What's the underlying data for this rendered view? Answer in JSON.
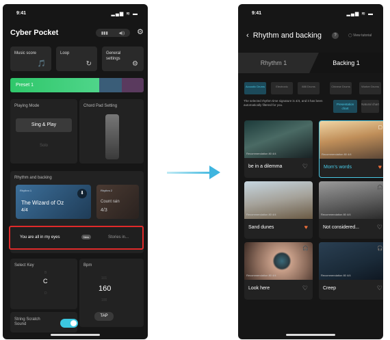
{
  "left": {
    "status": {
      "time": "9:41",
      "icons": "▂▄▆ ≋ ▬"
    },
    "app_title": "Cyber Pocket",
    "header_toggles": [
      "▮▮▮",
      "◀))"
    ],
    "nav_cards": [
      {
        "label": "Music score",
        "icon": "🎵"
      },
      {
        "label": "Loop",
        "icon": "↻"
      },
      {
        "label": "General settings",
        "icon": "⚙"
      }
    ],
    "preset": {
      "label": "Preset 1"
    },
    "playing_mode": {
      "title": "Playing Mode",
      "option1": "Sing & Play",
      "option2": "Solo"
    },
    "chord_pad": {
      "title": "Chord Pad Setting"
    },
    "rhythm_section": {
      "title": "Rhythm and backing",
      "card_active": {
        "tag": "Rhythm 1",
        "name": "The Wizard of Oz",
        "signature": "4/4"
      },
      "card_inactive": {
        "tag": "Rhythm 2",
        "name": "Count rain",
        "signature": "4/3"
      }
    },
    "highlighted_row": {
      "song": "You are all in my eyes",
      "badge": "New",
      "story": "Stories in..."
    },
    "select_key": {
      "title": "Select Key",
      "above": "B",
      "value": "C",
      "below": "D"
    },
    "bpm": {
      "title": "Bpm",
      "above": "101",
      "value": "160",
      "below": "100",
      "tap": "TAP"
    },
    "string_scratch": {
      "label": "String Scratch Sound",
      "enabled": true
    }
  },
  "right": {
    "status": {
      "time": "9:41",
      "icons": "▂▄▆ ≋ ▬"
    },
    "nav": {
      "title": "Rhythm and backing",
      "help": "?",
      "video_label": "◯ View tutorial"
    },
    "tabs": [
      "Rhythm 1",
      "Backing 1"
    ],
    "chips": [
      "Acoustic Drums",
      "Electronic",
      "888 Drums",
      "Chinese Drums",
      "Worker Drums"
    ],
    "info_text": "The selected rhythm time signature is 4/4, and it has been automatically filtered for you.",
    "filter_buttons": [
      "Presentation chart",
      "Natural chart"
    ],
    "cards": [
      {
        "title": "be in a dilemma",
        "meta": "Recommendation  80  4/4",
        "liked": false,
        "selected": false,
        "headphones": false
      },
      {
        "title": "Mom's words",
        "meta": "Recommendation  80  4/4",
        "liked": true,
        "selected": true,
        "headphones": false
      },
      {
        "title": "Sand dunes",
        "meta": "Recommendation  80  4/4",
        "liked": true,
        "selected": false,
        "headphones": false
      },
      {
        "title": "Not considered...",
        "meta": "Recommendation  80  4/4",
        "liked": false,
        "selected": false,
        "headphones": true
      },
      {
        "title": "Look here",
        "meta": "Recommendation  80  4/4",
        "liked": false,
        "selected": false,
        "headphones": true
      },
      {
        "title": "Creep",
        "meta": "Recommendation  80  4/4",
        "liked": false,
        "selected": false,
        "headphones": true
      }
    ]
  }
}
